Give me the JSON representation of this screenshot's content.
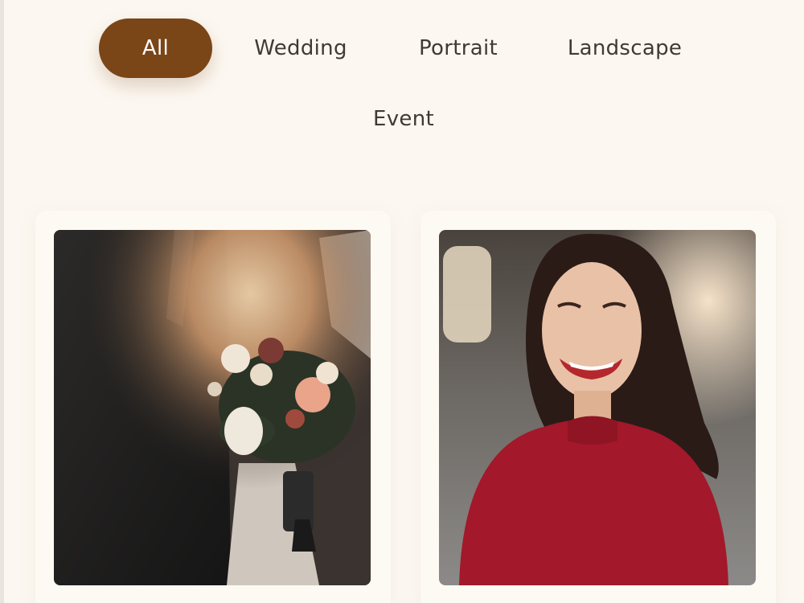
{
  "filters": {
    "all": "All",
    "wedding": "Wedding",
    "portrait": "Portrait",
    "landscape": "Landscape",
    "event": "Event"
  },
  "colors": {
    "background": "#fcf8f1",
    "accent": "#7a4517",
    "text": "#3f3a34"
  },
  "gallery": {
    "items": [
      {
        "icon": "wedding-bouquet-photo"
      },
      {
        "icon": "smiling-woman-portrait-photo"
      }
    ]
  }
}
